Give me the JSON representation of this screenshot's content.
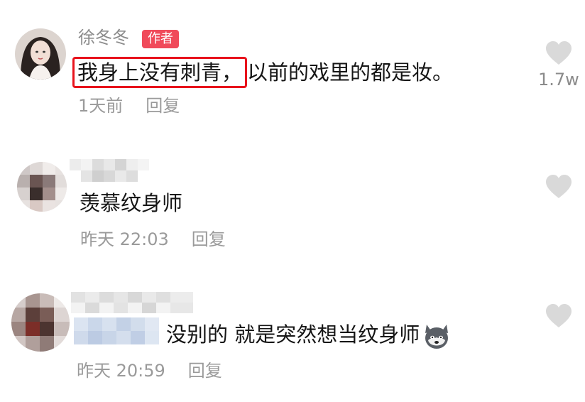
{
  "comments": [
    {
      "author": "徐冬冬",
      "badge": "作者",
      "text": "以前的戏里的都是妆。",
      "highlight_text": "我身上没有刺青，",
      "time": "1天前",
      "reply_label": "回复",
      "likes": "1.7w",
      "avatar": "author-avatar"
    },
    {
      "author": "",
      "text": "羡慕纹身师",
      "time": "昨天 22:03",
      "reply_label": "回复",
      "avatar": "blurred-avatar"
    },
    {
      "author": "",
      "mention": "",
      "text": "没别的 就是突然想当纹身师",
      "emoji": "husky-dog-icon",
      "time": "昨天 20:59",
      "reply_label": "回复",
      "avatar": "blurred-avatar"
    }
  ],
  "colors": {
    "badge": "#f04a5a",
    "highlight_border": "#e8131c",
    "meta_text": "#9a9a9a"
  }
}
